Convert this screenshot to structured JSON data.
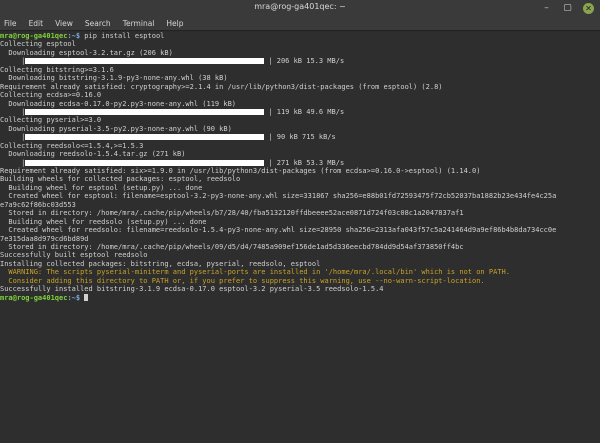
{
  "window": {
    "title": "mra@rog-ga401qec: ~",
    "controls": {
      "minimize": "–",
      "maximize": "▢",
      "close": "✕"
    }
  },
  "menu": [
    "File",
    "Edit",
    "View",
    "Search",
    "Terminal",
    "Help"
  ],
  "terminal": {
    "prompt_user": "mra@rog-ga401qec",
    "prompt_path": ":~$",
    "command": " pip install esptool",
    "lines": [
      {
        "t": "Collecting esptool"
      },
      {
        "t": "  Downloading esptool-3.2.tar.gz (206 kB)"
      },
      {
        "bar": true,
        "pre": "     |",
        "post": "| 206 kB 15.3 MB/s"
      },
      {
        "t": "Collecting bitstring>=3.1.6"
      },
      {
        "t": "  Downloading bitstring-3.1.9-py3-none-any.whl (38 kB)"
      },
      {
        "t": "Requirement already satisfied: cryptography>=2.1.4 in /usr/lib/python3/dist-packages (from esptool) (2.8)"
      },
      {
        "t": "Collecting ecdsa>=0.16.0"
      },
      {
        "t": "  Downloading ecdsa-0.17.0-py2.py3-none-any.whl (119 kB)"
      },
      {
        "bar": true,
        "pre": "     |",
        "post": "| 119 kB 49.6 MB/s"
      },
      {
        "t": "Collecting pyserial>=3.0"
      },
      {
        "t": "  Downloading pyserial-3.5-py2.py3-none-any.whl (90 kB)"
      },
      {
        "bar": true,
        "pre": "     |",
        "post": "| 90 kB 715 kB/s"
      },
      {
        "t": "Collecting reedsolo<=1.5.4,>=1.5.3"
      },
      {
        "t": "  Downloading reedsolo-1.5.4.tar.gz (271 kB)"
      },
      {
        "bar": true,
        "pre": "     |",
        "post": "| 271 kB 53.3 MB/s"
      },
      {
        "t": "Requirement already satisfied: six>=1.9.0 in /usr/lib/python3/dist-packages (from ecdsa>=0.16.0->esptool) (1.14.0)"
      },
      {
        "t": "Building wheels for collected packages: esptool, reedsolo"
      },
      {
        "t": "  Building wheel for esptool (setup.py) ... done"
      },
      {
        "t": "  Created wheel for esptool: filename=esptool-3.2-py3-none-any.whl size=331867 sha256=e88b01fd72593475f72cb52037ba1882b23e434fe4c25a"
      },
      {
        "t": "e7a9c62f86bc03d553"
      },
      {
        "t": "  Stored in directory: /home/mra/.cache/pip/wheels/b7/28/40/fba5132120ffdbeeee52ace0871d724f03c08c1a2047837af1"
      },
      {
        "t": "  Building wheel for reedsolo (setup.py) ... done"
      },
      {
        "t": "  Created wheel for reedsolo: filename=reedsolo-1.5.4-py3-none-any.whl size=28950 sha256=2313afa043f57c5a241464d9a9ef86b4b8da734cc0e"
      },
      {
        "t": "7e315daa8d979cd6bd89d"
      },
      {
        "t": "  Stored in directory: /home/mra/.cache/pip/wheels/09/d5/d4/7485a909ef156de1ad5d336eecbd784dd9d54af373850ff4bc"
      },
      {
        "t": "Successfully built esptool reedsolo"
      },
      {
        "t": "Installing collected packages: bitstring, ecdsa, pyserial, reedsolo, esptool"
      },
      {
        "t": "  WARNING: The scripts pyserial-miniterm and pyserial-ports are installed in '/home/mra/.local/bin' which is not on PATH.",
        "warn": true
      },
      {
        "t": "  Consider adding this directory to PATH or, if you prefer to suppress this warning, use --no-warn-script-location.",
        "warn": true
      },
      {
        "t": "Successfully installed bitstring-3.1.9 ecdsa-0.17.0 esptool-3.2 pyserial-3.5 reedsolo-1.5.4"
      }
    ],
    "final_prompt_user": "mra@rog-ga401qec",
    "final_prompt_path": ":~$"
  }
}
